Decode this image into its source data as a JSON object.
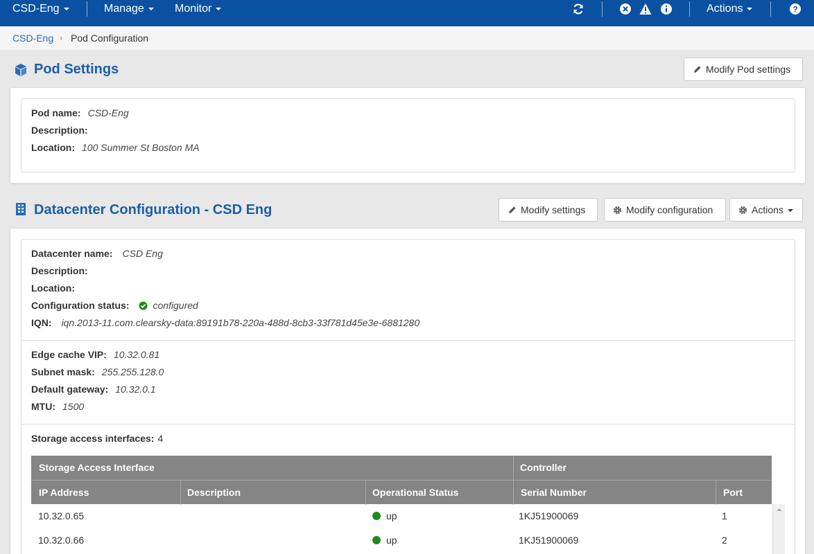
{
  "topnav": {
    "pod_menu": "CSD-Eng",
    "manage_menu": "Manage",
    "monitor_menu": "Monitor",
    "actions_menu": "Actions",
    "icons": [
      "refresh-icon",
      "error-icon",
      "warning-icon",
      "info-icon",
      "help-icon"
    ]
  },
  "breadcrumb": {
    "root": "CSD-Eng",
    "current": "Pod Configuration"
  },
  "pod_settings": {
    "title": "Pod Settings",
    "modify_button": "Modify Pod settings",
    "fields": {
      "name_label": "Pod name:",
      "name_value": "CSD-Eng",
      "description_label": "Description:",
      "location_label": "Location:",
      "location_value": "100 Summer St Boston MA"
    }
  },
  "datacenter": {
    "title": "Datacenter Configuration - CSD Eng",
    "modify_settings_button": "Modify settings",
    "modify_configuration_button": "Modify configuration",
    "actions_button": "Actions",
    "fields": {
      "name_label": "Datacenter name:",
      "name_value": "CSD Eng",
      "description_label": "Description:",
      "location_label": "Location:",
      "status_label": "Configuration status:",
      "status_value": "configured",
      "iqn_label": "IQN:",
      "iqn_value": "iqn.2013-11.com.clearsky-data:89191b78-220a-488d-8cb3-33f781d45e3e-6881280"
    },
    "network": {
      "vip_label": "Edge cache VIP:",
      "vip_value": "10.32.0.81",
      "subnet_label": "Subnet mask:",
      "subnet_value": "255.255.128.0",
      "gateway_label": "Default gateway:",
      "gateway_value": "10.32.0.1",
      "mtu_label": "MTU:",
      "mtu_value": "1500"
    },
    "storage": {
      "count_label": "Storage access interfaces:",
      "count_value": "4",
      "group_headers": {
        "sai": "Storage Access Interface",
        "controller": "Controller"
      },
      "columns": {
        "ip": "IP Address",
        "description": "Description",
        "status": "Operational Status",
        "serial": "Serial Number",
        "port": "Port"
      },
      "rows": [
        {
          "ip": "10.32.0.65",
          "description": "",
          "status": "up",
          "serial": "1KJ51900069",
          "port": "1"
        },
        {
          "ip": "10.32.0.66",
          "description": "",
          "status": "up",
          "serial": "1KJ51900069",
          "port": "2"
        }
      ]
    }
  },
  "colors": {
    "nav_bg": "#0a51a1",
    "title_blue": "#1c5ea8",
    "status_green": "#1f8a1f",
    "table_header": "#858585"
  }
}
